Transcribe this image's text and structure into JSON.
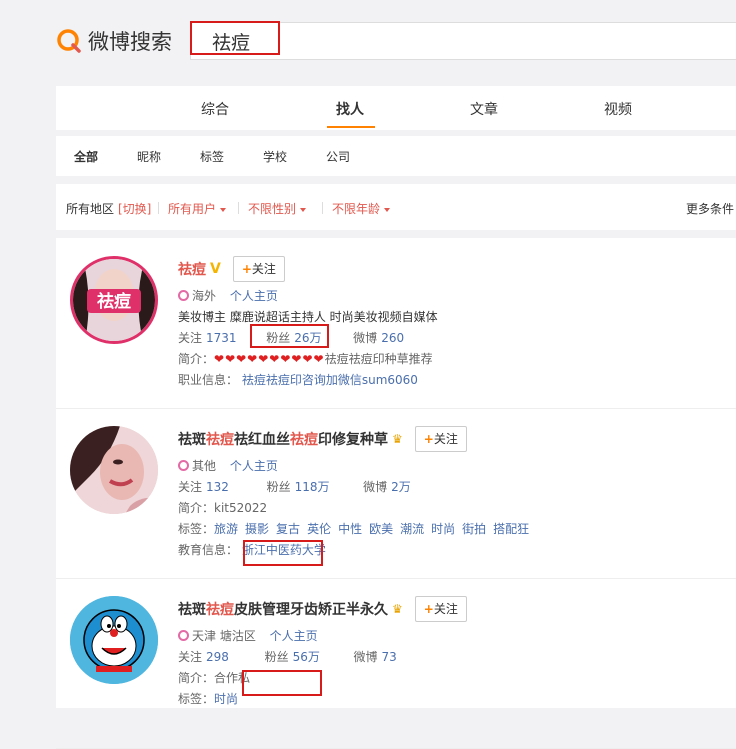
{
  "logo": {
    "text": "微博搜索"
  },
  "search": {
    "value": "祛痘"
  },
  "tabs": [
    "综合",
    "找人",
    "文章",
    "视频"
  ],
  "subtabs": [
    "全部",
    "昵称",
    "标签",
    "学校",
    "公司"
  ],
  "filters": {
    "region": "所有地区",
    "switch": "[切换]",
    "users": "所有用户",
    "gender": "不限性别",
    "age": "不限年龄",
    "more": "更多条件"
  },
  "results": [
    {
      "name_parts": [
        "祛痘",
        "",
        ""
      ],
      "avatar_text": "祛痘",
      "verified": "V",
      "follow": "关注",
      "location": "海外",
      "homepage": "个人主页",
      "desc": "美妆博主 糜鹿说超话主持人 时尚美妆视频自媒体",
      "follow_label": "关注",
      "follow_count": "1731",
      "fans_label": "粉丝",
      "fans_count": "26万",
      "weibo_label": "微博",
      "weibo_count": "260",
      "intro_label": "简介：",
      "intro_hearts": "❤❤❤❤❤❤❤❤❤❤",
      "intro_text": "祛痘祛痘印种草推荐",
      "job_label": "职业信息：",
      "job_text": "祛痘祛痘印咨询加微信sum6060"
    },
    {
      "name_a": "祛斑",
      "name_b": "祛痘",
      "name_c": "祛红血丝",
      "name_d": "祛痘",
      "name_e": "印修复种草",
      "follow": "关注",
      "location": "其他",
      "homepage": "个人主页",
      "follow_label": "关注",
      "follow_count": "132",
      "fans_label": "粉丝",
      "fans_count": "118万",
      "weibo_label": "微博",
      "weibo_count": "2万",
      "intro_label": "简介：",
      "intro_text": "kit52022",
      "tags_label": "标签：",
      "tags": [
        "旅游",
        "摄影",
        "复古",
        "英伦",
        "中性",
        "欧美",
        "潮流",
        "时尚",
        "街拍",
        "搭配狂"
      ],
      "edu_label": "教育信息：",
      "edu_text": "浙江中医药大学"
    },
    {
      "name_a": "祛斑",
      "name_b": "祛痘",
      "name_c": "皮肤管理牙齿矫正半永久",
      "follow": "关注",
      "location": "天津 塘沽区",
      "homepage": "个人主页",
      "follow_label": "关注",
      "follow_count": "298",
      "fans_label": "粉丝",
      "fans_count": "56万",
      "weibo_label": "微博",
      "weibo_count": "73",
      "intro_label": "简介：",
      "intro_text": "合作私",
      "tags_label": "标签：",
      "tags_partial": "时尚"
    }
  ],
  "colors": {
    "accent": "#ff8200",
    "highlight": "#e2584e",
    "link": "#4a6fad",
    "annotation": "#d71a1a"
  }
}
